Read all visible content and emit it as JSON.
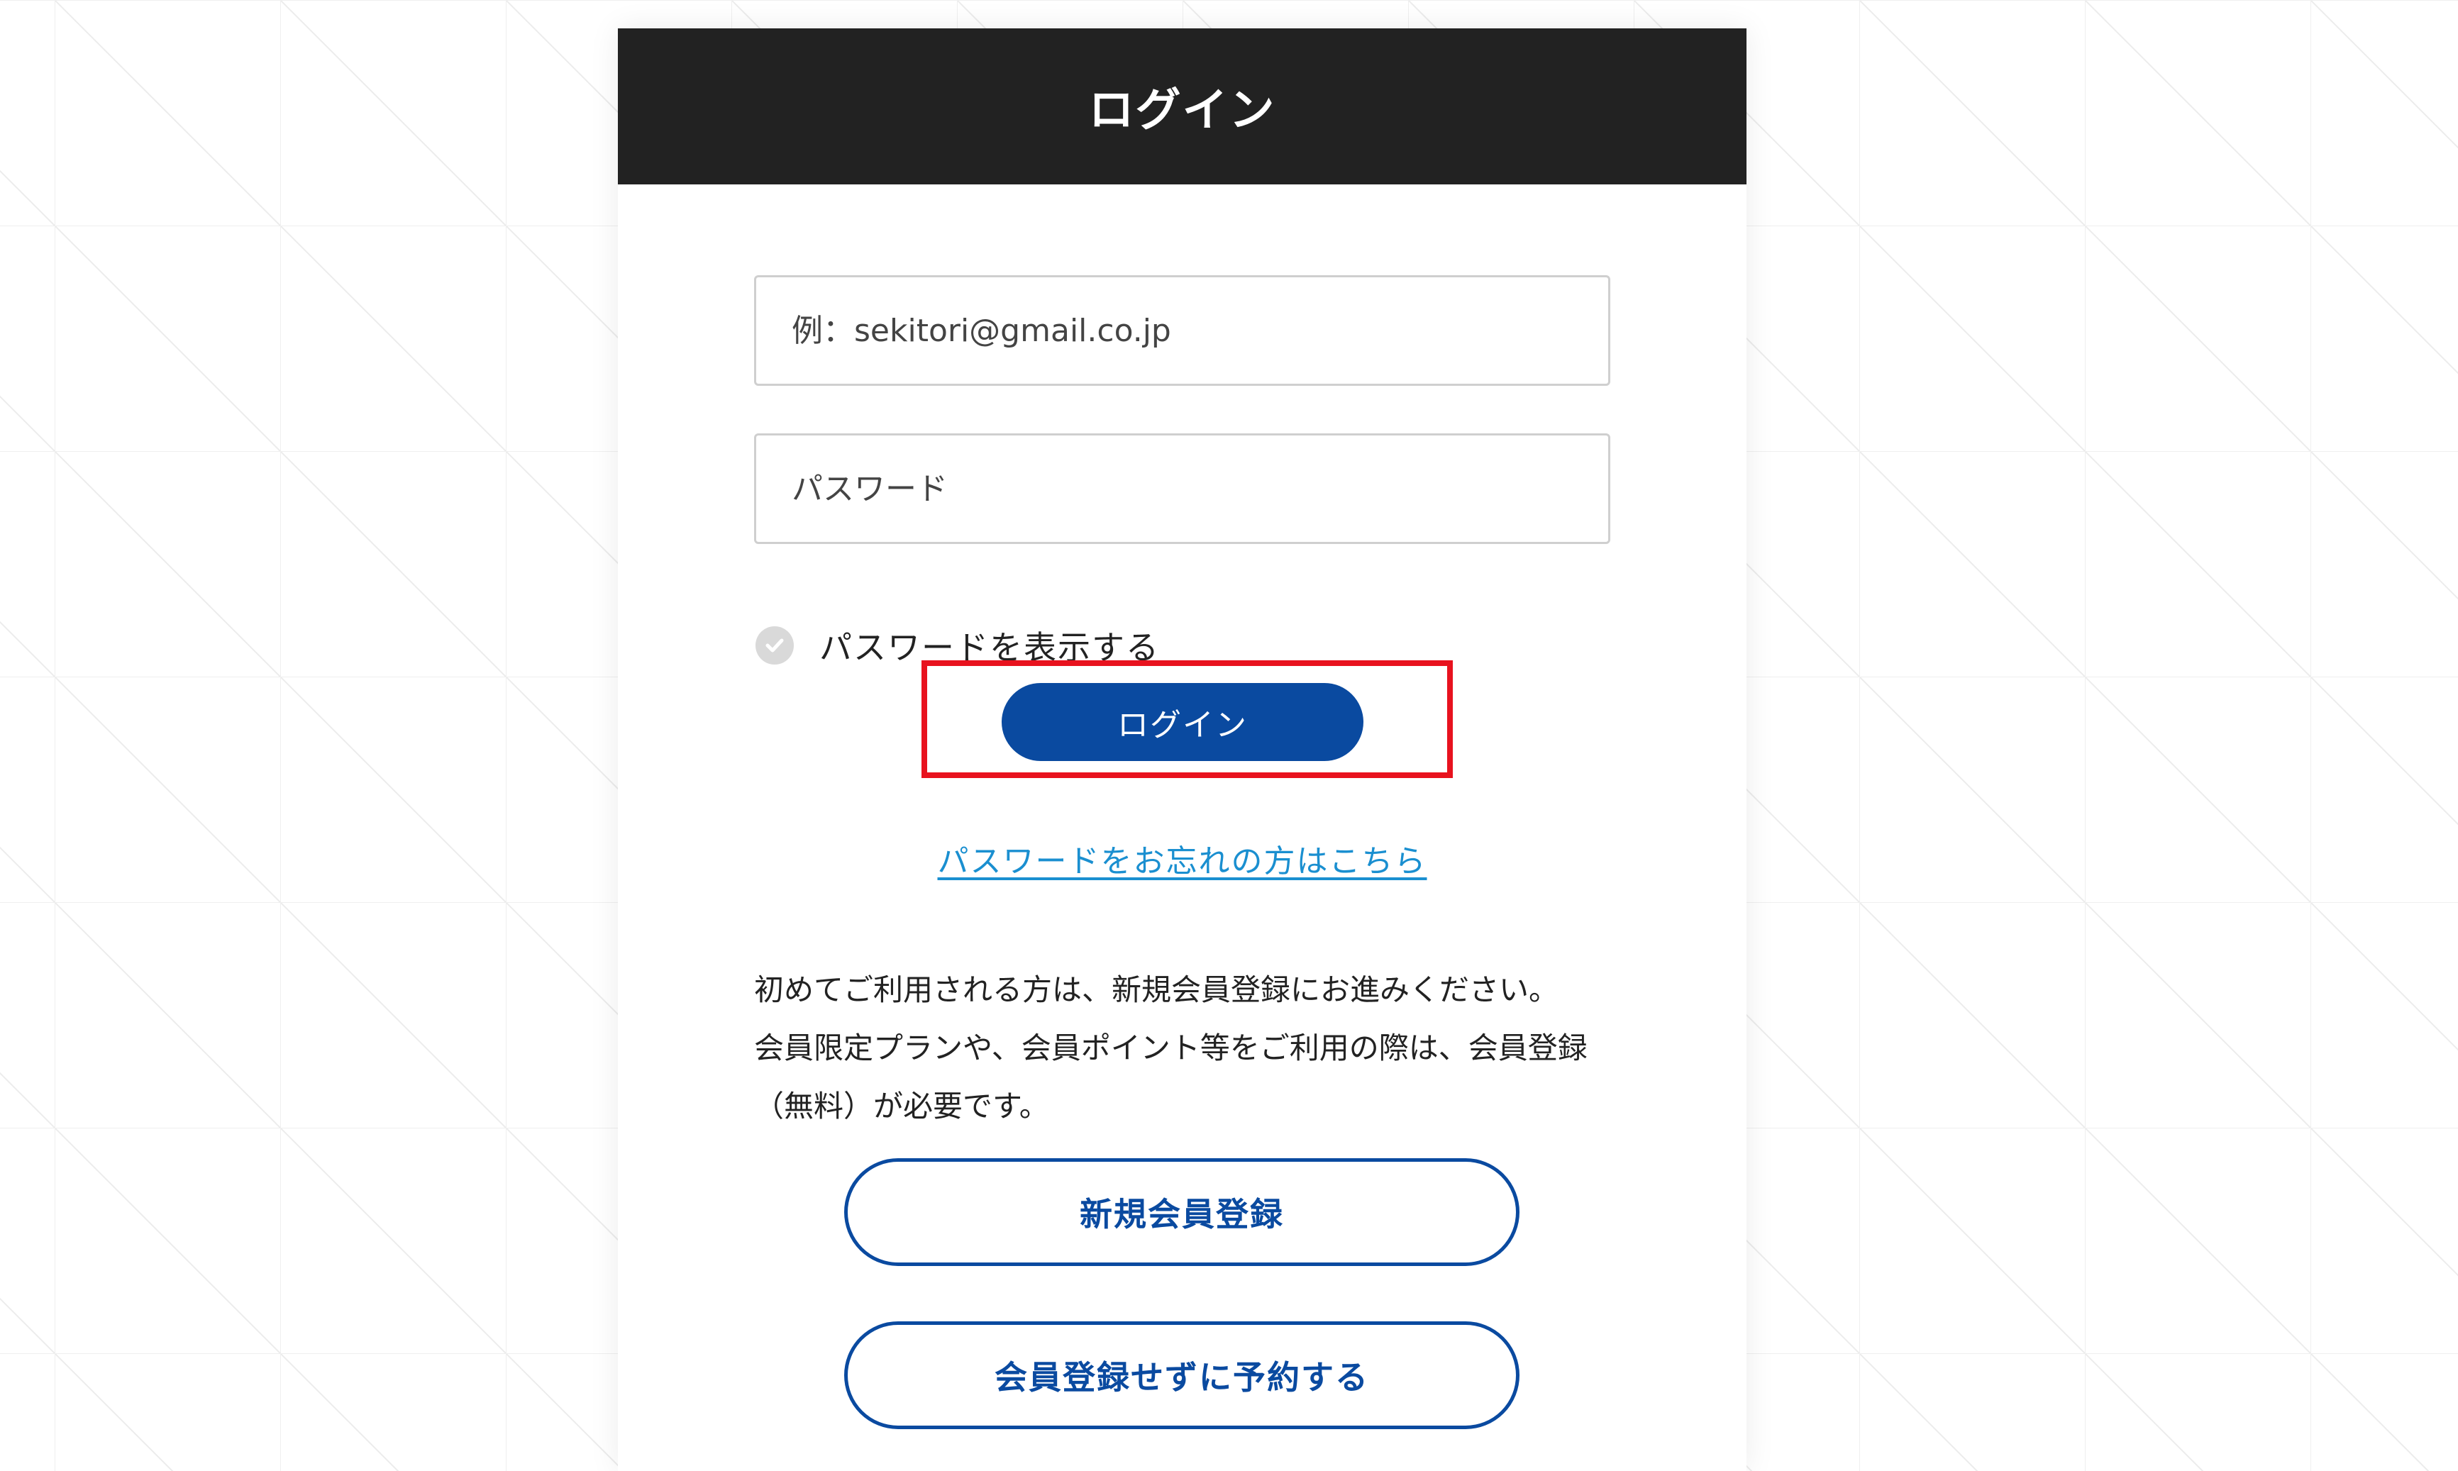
{
  "header": {
    "title": "ログイン"
  },
  "form": {
    "email_placeholder": "例：sekitori@gmail.co.jp",
    "password_placeholder": "パスワード",
    "show_password_label": "パスワードを表示する",
    "login_button_label": "ログイン",
    "forgot_password_link": "パスワードをお忘れの方はこちら"
  },
  "info": {
    "lines": [
      "初めてご利用される方は、新規会員登録にお進みください。",
      "会員限定プランや、会員ポイント等をご利用の際は、会員登録",
      "（無料）が必要です。"
    ]
  },
  "actions": {
    "register_label": "新規会員登録",
    "guest_label": "会員登録せずに予約する"
  },
  "colors": {
    "header_bg": "#222222",
    "primary": "#0a4aa0",
    "link": "#1a8fd0",
    "highlight": "#e8121e"
  },
  "icons": {
    "show_password": "check-circle-icon"
  }
}
